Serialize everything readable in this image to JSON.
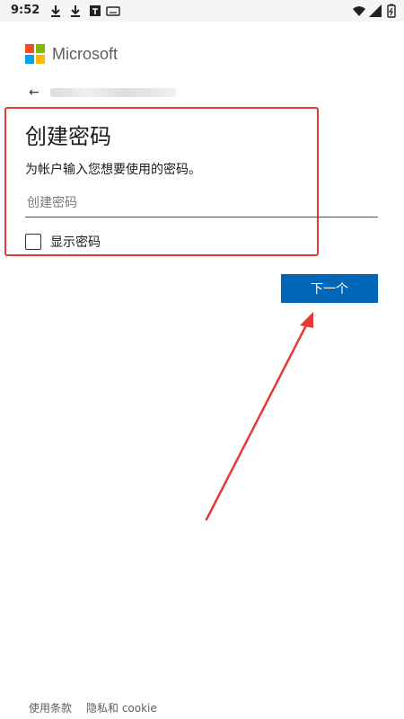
{
  "status_bar": {
    "time": "9:52",
    "left_icons": [
      "download-icon",
      "download-icon",
      "text-box-icon",
      "keyboard-icon"
    ],
    "right_icons": [
      "wifi-icon",
      "signal-icon",
      "battery-icon"
    ]
  },
  "brand": {
    "name": "Microsoft",
    "logo_colors": [
      "#f25022",
      "#7fba00",
      "#00a4ef",
      "#ffb900"
    ]
  },
  "form": {
    "title": "创建密码",
    "subtitle": "为帐户输入您想要使用的密码。",
    "password_placeholder": "创建密码",
    "password_value": "",
    "show_password_label": "显示密码",
    "show_password_checked": false,
    "next_label": "下一个"
  },
  "footer": {
    "terms": "使用条款",
    "privacy": "隐私和 cookie"
  },
  "colors": {
    "accent": "#0067b8",
    "annotation": "#e53935"
  }
}
